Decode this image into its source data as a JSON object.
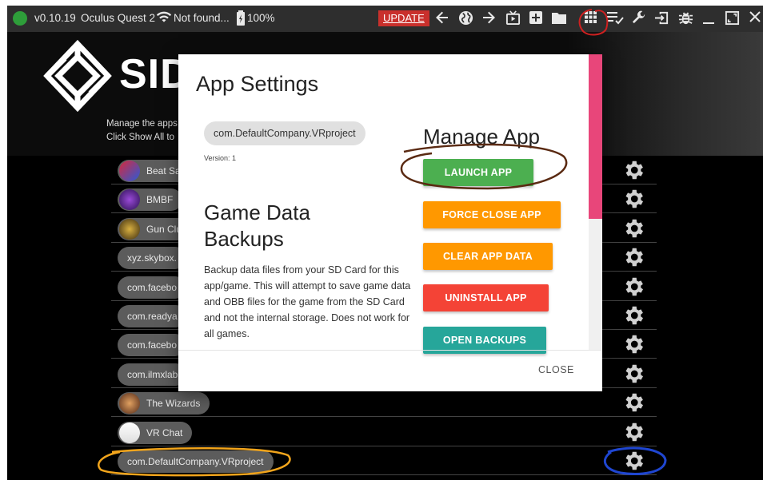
{
  "toolbar": {
    "version": "v0.10.19",
    "device": "Oculus Quest 2",
    "wifi_status": "Not found...",
    "battery": "100%",
    "update_label": "UPDATE",
    "icons": [
      "back-arrow-icon",
      "globe-icon",
      "forward-arrow-icon",
      "tv-icon",
      "add-box-icon",
      "folder-icon",
      "grid-icon",
      "playlist-icon",
      "wrench-icon",
      "exit-icon",
      "bug-icon",
      "minimize-icon",
      "maximize-icon",
      "close-icon"
    ]
  },
  "header": {
    "logo_text": "SID",
    "desc_line1": "Manage the apps",
    "desc_line2": "Click Show All to"
  },
  "apps": [
    {
      "label": "Beat Sa",
      "icon": "beat-saber-icon"
    },
    {
      "label": "BMBF",
      "icon": "bmbf-icon"
    },
    {
      "label": "Gun Clu",
      "icon": "gun-club-icon"
    },
    {
      "label": "xyz.skybox.",
      "icon": ""
    },
    {
      "label": "com.facebo",
      "icon": ""
    },
    {
      "label": "com.readya",
      "icon": ""
    },
    {
      "label": "com.facebo",
      "icon": ""
    },
    {
      "label": "com.ilmxlab",
      "icon": ""
    },
    {
      "label": "The Wizards",
      "icon": "the-wizards-icon"
    },
    {
      "label": "VR Chat",
      "icon": "vrchat-icon"
    },
    {
      "label": "com.DefaultCompany.VRproject",
      "icon": ""
    }
  ],
  "modal": {
    "title": "App Settings",
    "package": "com.DefaultCompany.VRproject",
    "version": "Version: 1",
    "backups_title_line1": "Game Data",
    "backups_title_line2": "Backups",
    "backups_desc": "Backup data files from your SD Card for this app/game. This will attempt to save game data and OBB files for the game from the SD Card and not the internal storage. Does not work for all games.",
    "manage_title": "Manage App",
    "buttons": {
      "launch": "LAUNCH APP",
      "force_close": "FORCE CLOSE APP",
      "clear_data": "CLEAR APP DATA",
      "uninstall": "UNINSTALL APP",
      "open_backups": "OPEN BACKUPS"
    },
    "close_label": "CLOSE"
  },
  "colors": {
    "launch": "#4caf50",
    "force_close": "#ff9800",
    "clear_data": "#ff9800",
    "uninstall": "#f44336",
    "open_backups": "#26a69a",
    "scroll_thumb": "#e8467a",
    "update": "#c9302c"
  }
}
